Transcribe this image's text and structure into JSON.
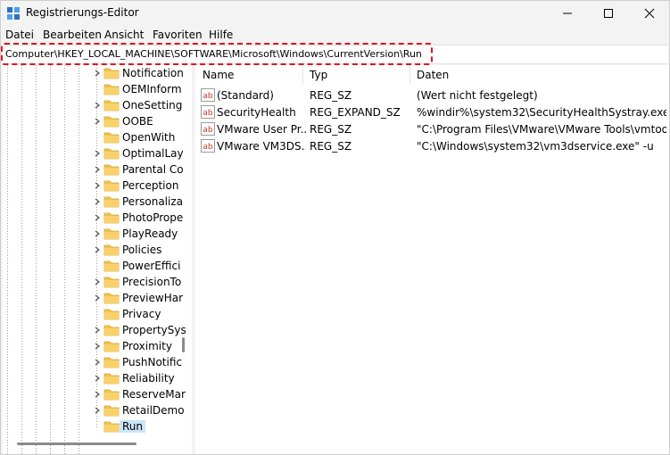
{
  "window": {
    "title": "Registrierungs-Editor"
  },
  "menu": [
    "Datei",
    "Bearbeiten",
    "Ansicht",
    "Favoriten",
    "Hilfe"
  ],
  "address": "Computer\\HKEY_LOCAL_MACHINE\\SOFTWARE\\Microsoft\\Windows\\CurrentVersion\\Run",
  "tree": {
    "items": [
      {
        "label": "Notification",
        "expandable": true
      },
      {
        "label": "OEMInform",
        "expandable": false
      },
      {
        "label": "OneSetting",
        "expandable": true
      },
      {
        "label": "OOBE",
        "expandable": true
      },
      {
        "label": "OpenWith",
        "expandable": false
      },
      {
        "label": "OptimalLay",
        "expandable": true
      },
      {
        "label": "Parental Co",
        "expandable": true
      },
      {
        "label": "Perception",
        "expandable": true
      },
      {
        "label": "Personaliza",
        "expandable": true
      },
      {
        "label": "PhotoPrope",
        "expandable": true
      },
      {
        "label": "PlayReady",
        "expandable": true
      },
      {
        "label": "Policies",
        "expandable": true
      },
      {
        "label": "PowerEffici",
        "expandable": false
      },
      {
        "label": "PrecisionTo",
        "expandable": true
      },
      {
        "label": "PreviewHar",
        "expandable": true
      },
      {
        "label": "Privacy",
        "expandable": false
      },
      {
        "label": "PropertySys",
        "expandable": true
      },
      {
        "label": "Proximity",
        "expandable": true
      },
      {
        "label": "PushNotific",
        "expandable": true
      },
      {
        "label": "Reliability",
        "expandable": true
      },
      {
        "label": "ReserveMar",
        "expandable": true
      },
      {
        "label": "RetailDemo",
        "expandable": true
      },
      {
        "label": "Run",
        "expandable": false,
        "selected": true
      }
    ]
  },
  "list": {
    "columns": [
      "Name",
      "Typ",
      "Daten"
    ],
    "rows": [
      {
        "name": "(Standard)",
        "type": "REG_SZ",
        "data": "(Wert nicht festgelegt)"
      },
      {
        "name": "SecurityHealth",
        "type": "REG_EXPAND_SZ",
        "data": "%windir%\\system32\\SecurityHealthSystray.exe"
      },
      {
        "name": "VMware User Pr...",
        "type": "REG_SZ",
        "data": "\"C:\\Program Files\\VMware\\VMware Tools\\vmtools..."
      },
      {
        "name": "VMware VM3DS...",
        "type": "REG_SZ",
        "data": "\"C:\\Windows\\system32\\vm3dservice.exe\" -u"
      }
    ]
  },
  "colors": {
    "highlight_border": "#e0141e",
    "folder": "#f2c24e",
    "selection": "#cce4f7",
    "string_icon": "#c0392b"
  }
}
